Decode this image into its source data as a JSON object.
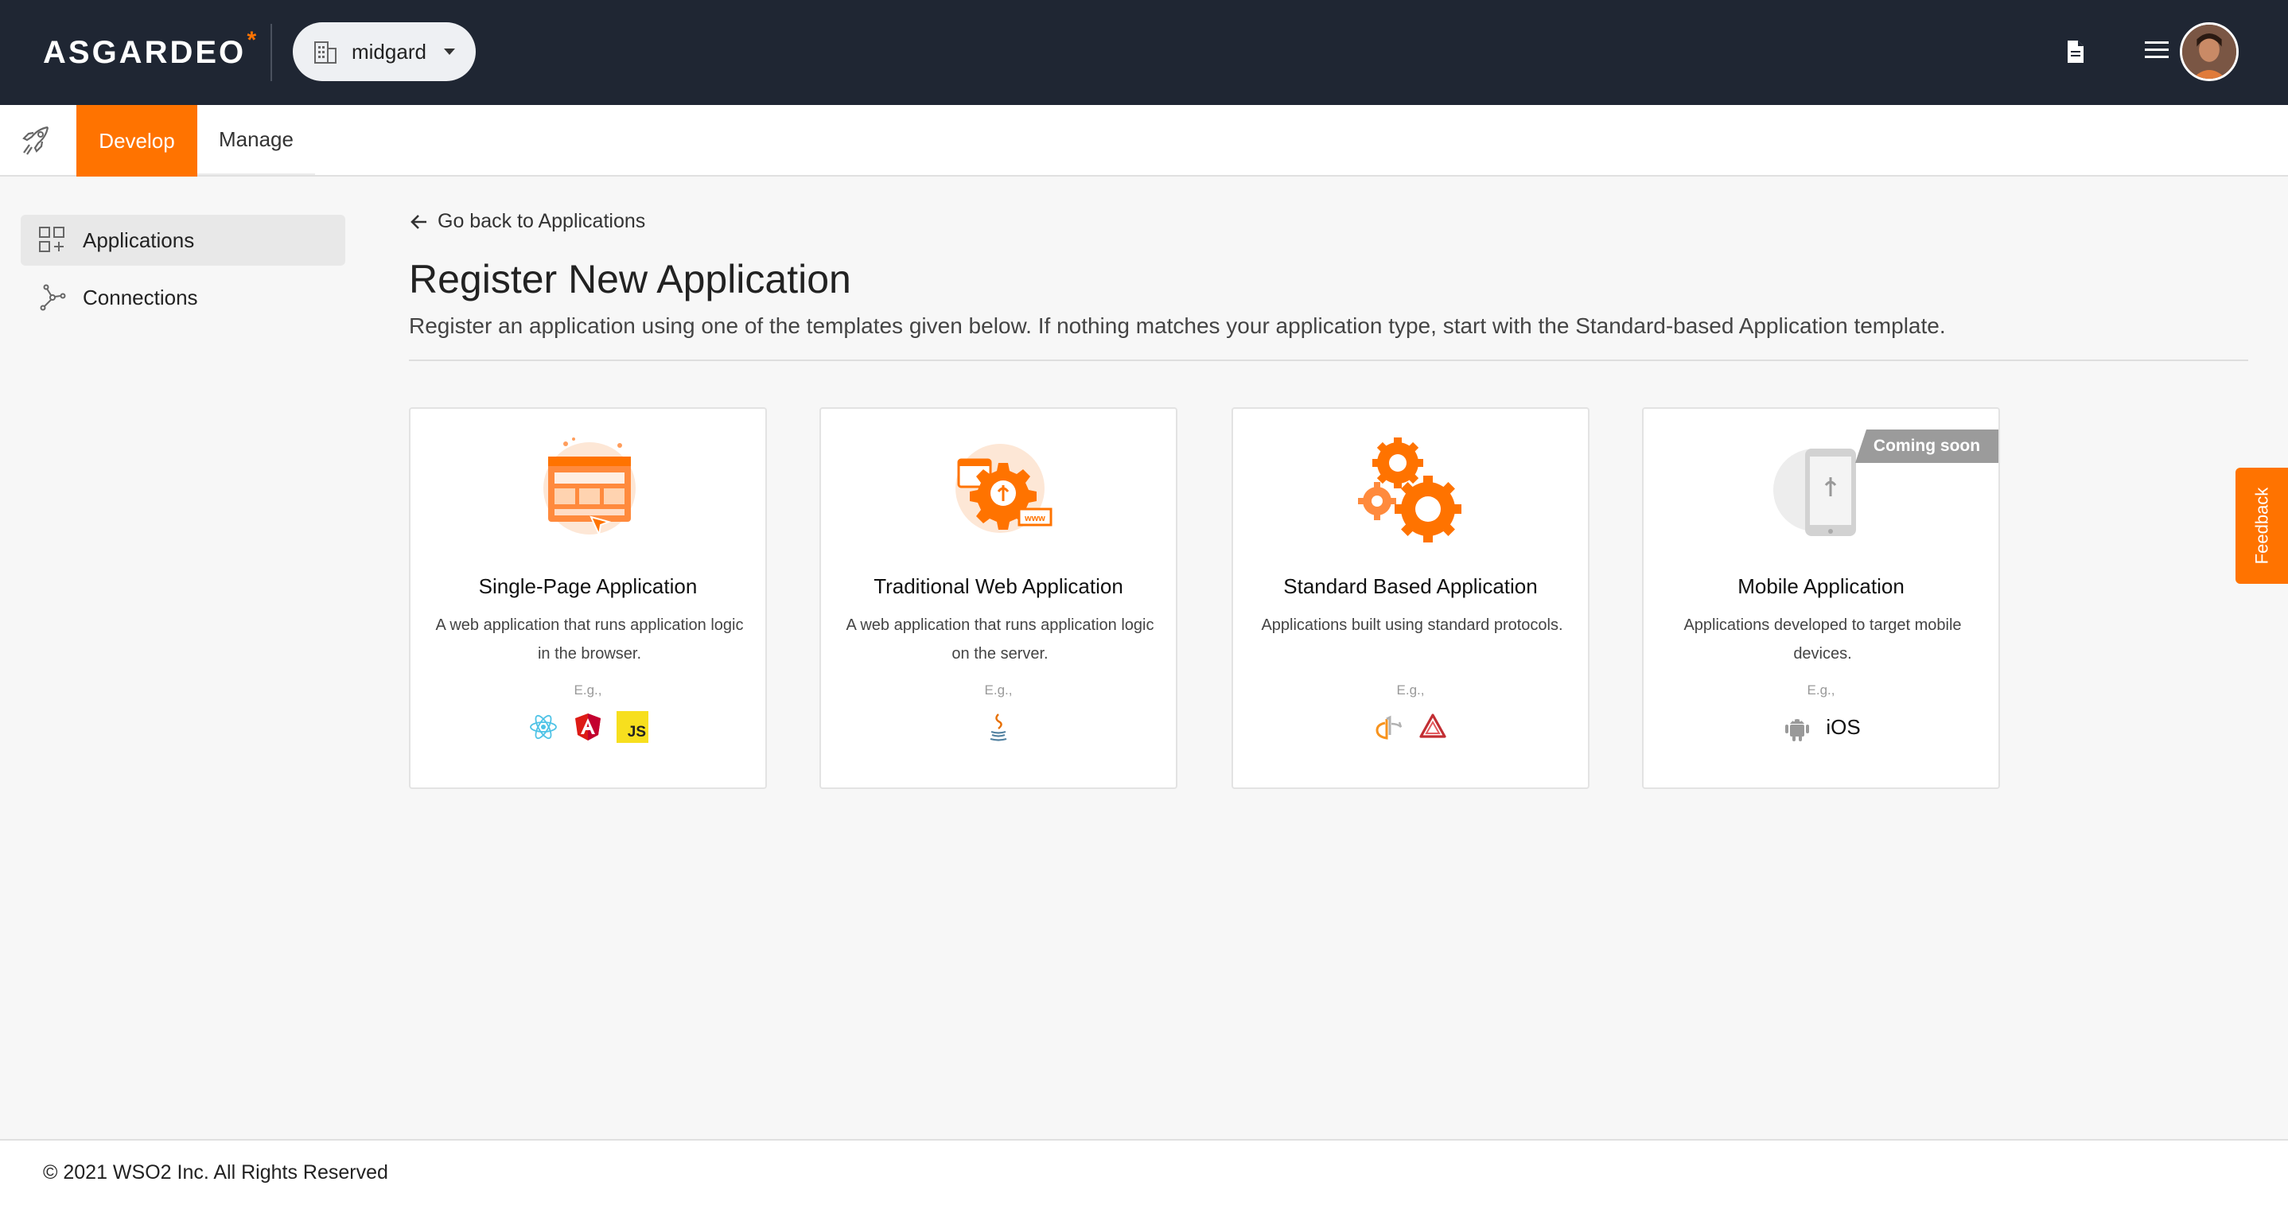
{
  "header": {
    "logo_text": "ASGARDEO",
    "logo_mark": "*",
    "organization": "midgard",
    "icons": [
      "building-icon",
      "document-icon",
      "hamburger-menu-icon",
      "user-avatar"
    ]
  },
  "tabs": {
    "develop": "Develop",
    "manage": "Manage",
    "active": "Develop"
  },
  "sidebar": {
    "items": [
      {
        "label": "Applications",
        "icon": "applications-grid-icon",
        "active": true
      },
      {
        "label": "Connections",
        "icon": "connections-icon",
        "active": false
      }
    ]
  },
  "main": {
    "back_link": "Go back to Applications",
    "title": "Register New Application",
    "description": "Register an application using one of the templates given below. If nothing matches your application type, start with the Standard-based Application template."
  },
  "cards": [
    {
      "title": "Single-Page Application",
      "description": "A web application that runs application logic in the browser.",
      "eg": "E.g.,",
      "techs": [
        "react-icon",
        "angular-icon",
        "javascript-icon"
      ],
      "tech_text": [
        "JS"
      ]
    },
    {
      "title": "Traditional Web Application",
      "description": "A web application that runs application logic on the server.",
      "eg": "E.g.,",
      "techs": [
        "java-icon"
      ]
    },
    {
      "title": "Standard Based Application",
      "description": "Applications built using standard protocols.",
      "eg": "E.g.,",
      "techs": [
        "openid-icon",
        "saml-icon"
      ]
    },
    {
      "title": "Mobile Application",
      "description": "Applications developed to target mobile devices.",
      "eg": "E.g.,",
      "badge": "Coming soon",
      "techs": [
        "android-icon"
      ],
      "tech_text": [
        "iOS"
      ]
    }
  ],
  "feedback": "Feedback",
  "footer": "© 2021 WSO2 Inc. All Rights Reserved",
  "colors": {
    "accent": "#ff7300",
    "header_bg": "#1f2633",
    "page_bg": "#f7f7f7",
    "badge_bg": "#9b9b9b"
  }
}
